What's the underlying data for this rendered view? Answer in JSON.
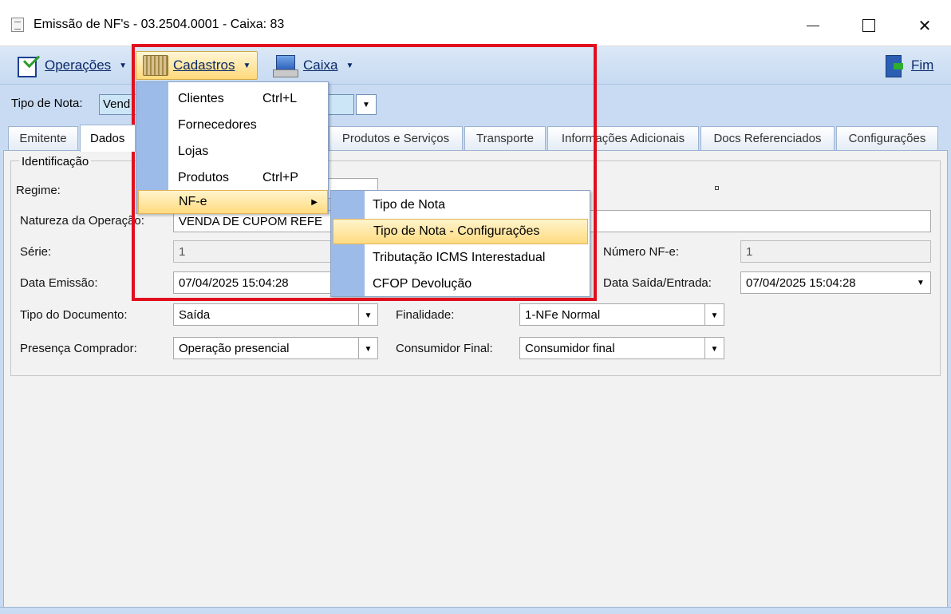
{
  "window": {
    "title": "Emissão de NF's - 03.2504.0001 - Caixa: 83"
  },
  "menubar": {
    "operacoes": "Operações",
    "cadastros": "Cadastros",
    "caixa": "Caixa",
    "fim": "Fim"
  },
  "tiponota": {
    "label": "Tipo de Nota:",
    "value": "Vend"
  },
  "tabs": [
    "Emitente",
    "Dados",
    "Produtos e Serviços",
    "Transporte",
    "Informações Adicionais",
    "Docs Referenciados",
    "Configurações"
  ],
  "form": {
    "group_title": "Identificação",
    "regime_label": "Regime:",
    "natureza_label": "Natureza da Operação:",
    "natureza_value": "VENDA DE CUPOM REFE",
    "serie_label": "Série:",
    "serie_value": "1",
    "numero_label": "Número NF-e:",
    "numero_value": "1",
    "data_emissao_label": "Data Emissão:",
    "data_emissao_value": "07/04/2025 15:04:28",
    "data_saida_label": "Data Saída/Entrada:",
    "data_saida_value": "07/04/2025 15:04:28",
    "tipo_doc_label": "Tipo do Documento:",
    "tipo_doc_value": "Saída",
    "finalidade_label": "Finalidade:",
    "finalidade_value": "1-NFe Normal",
    "presenca_label": "Presença Comprador:",
    "presenca_value": "Operação presencial",
    "consumidor_label": "Consumidor Final:",
    "consumidor_value": "Consumidor final"
  },
  "cadastros_menu": {
    "items": [
      {
        "label": "Clientes",
        "shortcut": "Ctrl+L"
      },
      {
        "label": "Fornecedores",
        "shortcut": ""
      },
      {
        "label": "Lojas",
        "shortcut": ""
      },
      {
        "label": "Produtos",
        "shortcut": "Ctrl+P"
      },
      {
        "label": "NF-e",
        "shortcut": ""
      }
    ]
  },
  "nfe_submenu": {
    "items": [
      {
        "label": "Tipo de Nota"
      },
      {
        "label": "Tipo de Nota - Configurações"
      },
      {
        "label": "Tributação ICMS Interestadual"
      },
      {
        "label": "CFOP Devolução"
      }
    ]
  },
  "colors": {
    "highlight_box": "#e0101e",
    "menu_highlight": "#ffdb80",
    "toolbar_bg": "#c6daf1"
  }
}
